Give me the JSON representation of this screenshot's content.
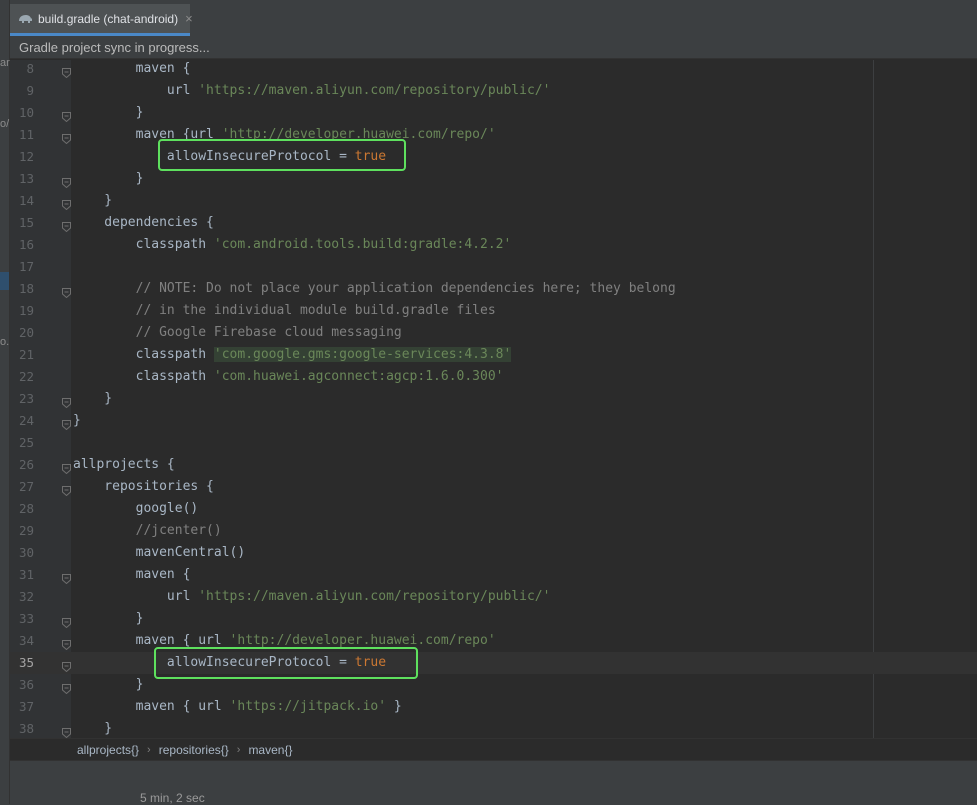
{
  "tab": {
    "label": "build.gradle (chat-android)",
    "close_glyph": "×",
    "icon": "gradle-elephant-icon"
  },
  "banner": {
    "text": "Gradle project sync in progress..."
  },
  "editor": {
    "current_line": "35",
    "lines": [
      {
        "n": "8",
        "fold": true,
        "tokens": [
          {
            "t": "        maven {",
            "c": ""
          }
        ]
      },
      {
        "n": "9",
        "fold": false,
        "tokens": [
          {
            "t": "            url ",
            "c": ""
          },
          {
            "t": "'https://maven.aliyun.com/repository/public/'",
            "c": "str"
          }
        ]
      },
      {
        "n": "10",
        "fold": true,
        "tokens": [
          {
            "t": "        }",
            "c": ""
          }
        ]
      },
      {
        "n": "11",
        "fold": true,
        "tokens": [
          {
            "t": "        maven {url ",
            "c": ""
          },
          {
            "t": "'http://developer.huawei.com/repo/'",
            "c": "str"
          }
        ]
      },
      {
        "n": "12",
        "fold": false,
        "tokens": [
          {
            "t": "            allowInsecureProtocol = ",
            "c": ""
          },
          {
            "t": "true",
            "c": "kw"
          }
        ]
      },
      {
        "n": "13",
        "fold": true,
        "tokens": [
          {
            "t": "        }",
            "c": ""
          }
        ]
      },
      {
        "n": "14",
        "fold": true,
        "tokens": [
          {
            "t": "    }",
            "c": ""
          }
        ]
      },
      {
        "n": "15",
        "fold": true,
        "tokens": [
          {
            "t": "    dependencies {",
            "c": ""
          }
        ]
      },
      {
        "n": "16",
        "fold": false,
        "tokens": [
          {
            "t": "        classpath ",
            "c": ""
          },
          {
            "t": "'com.android.tools.build:gradle:4.2.2'",
            "c": "str"
          }
        ]
      },
      {
        "n": "17",
        "fold": false,
        "tokens": [
          {
            "t": "",
            "c": ""
          }
        ]
      },
      {
        "n": "18",
        "fold": true,
        "tokens": [
          {
            "t": "        // NOTE: Do not place your application dependencies here; they belong",
            "c": "cmt"
          }
        ]
      },
      {
        "n": "19",
        "fold": false,
        "tokens": [
          {
            "t": "        // in the individual module build.gradle files",
            "c": "cmt"
          }
        ]
      },
      {
        "n": "20",
        "fold": false,
        "tokens": [
          {
            "t": "        // Google Firebase cloud messaging",
            "c": "cmt"
          }
        ]
      },
      {
        "n": "21",
        "fold": false,
        "tokens": [
          {
            "t": "        classpath ",
            "c": ""
          },
          {
            "t": "'com.google.gms:google-services:4.3.8'",
            "c": "str hl-str"
          }
        ]
      },
      {
        "n": "22",
        "fold": false,
        "tokens": [
          {
            "t": "        classpath ",
            "c": ""
          },
          {
            "t": "'com.huawei.agconnect:agcp:1.6.0.300'",
            "c": "str"
          }
        ]
      },
      {
        "n": "23",
        "fold": true,
        "tokens": [
          {
            "t": "    }",
            "c": ""
          }
        ]
      },
      {
        "n": "24",
        "fold": true,
        "tokens": [
          {
            "t": "}",
            "c": ""
          }
        ]
      },
      {
        "n": "25",
        "fold": false,
        "tokens": [
          {
            "t": "",
            "c": ""
          }
        ]
      },
      {
        "n": "26",
        "fold": true,
        "tokens": [
          {
            "t": "allprojects {",
            "c": ""
          }
        ]
      },
      {
        "n": "27",
        "fold": true,
        "tokens": [
          {
            "t": "    repositories {",
            "c": ""
          }
        ]
      },
      {
        "n": "28",
        "fold": false,
        "tokens": [
          {
            "t": "        google()",
            "c": ""
          }
        ]
      },
      {
        "n": "29",
        "fold": false,
        "tokens": [
          {
            "t": "        //jcenter()",
            "c": "cmt"
          }
        ]
      },
      {
        "n": "30",
        "fold": false,
        "tokens": [
          {
            "t": "        mavenCentral()",
            "c": ""
          }
        ]
      },
      {
        "n": "31",
        "fold": true,
        "tokens": [
          {
            "t": "        maven {",
            "c": ""
          }
        ]
      },
      {
        "n": "32",
        "fold": false,
        "tokens": [
          {
            "t": "            url ",
            "c": ""
          },
          {
            "t": "'https://maven.aliyun.com/repository/public/'",
            "c": "str"
          }
        ]
      },
      {
        "n": "33",
        "fold": true,
        "tokens": [
          {
            "t": "        }",
            "c": ""
          }
        ]
      },
      {
        "n": "34",
        "fold": true,
        "tokens": [
          {
            "t": "        maven { url ",
            "c": ""
          },
          {
            "t": "'http://developer.huawei.com/repo'",
            "c": "str"
          }
        ]
      },
      {
        "n": "35",
        "fold": true,
        "tokens": [
          {
            "t": "            allowInsecureProtocol = ",
            "c": ""
          },
          {
            "t": "true",
            "c": "kw"
          }
        ]
      },
      {
        "n": "36",
        "fold": true,
        "tokens": [
          {
            "t": "        }",
            "c": ""
          }
        ]
      },
      {
        "n": "37",
        "fold": false,
        "tokens": [
          {
            "t": "        maven { url ",
            "c": ""
          },
          {
            "t": "'https://jitpack.io'",
            "c": "str"
          },
          {
            "t": " }",
            "c": ""
          }
        ]
      },
      {
        "n": "38",
        "fold": true,
        "tokens": [
          {
            "t": "    }",
            "c": ""
          }
        ]
      }
    ]
  },
  "breadcrumb": {
    "items": [
      "allprojects{}",
      "repositories{}",
      "maven{}"
    ],
    "separator": "›"
  },
  "status": {
    "text": "5 min, 2 sec"
  },
  "colors": {
    "highlight_box": "#5ee05e",
    "accent": "#4a88c7"
  }
}
